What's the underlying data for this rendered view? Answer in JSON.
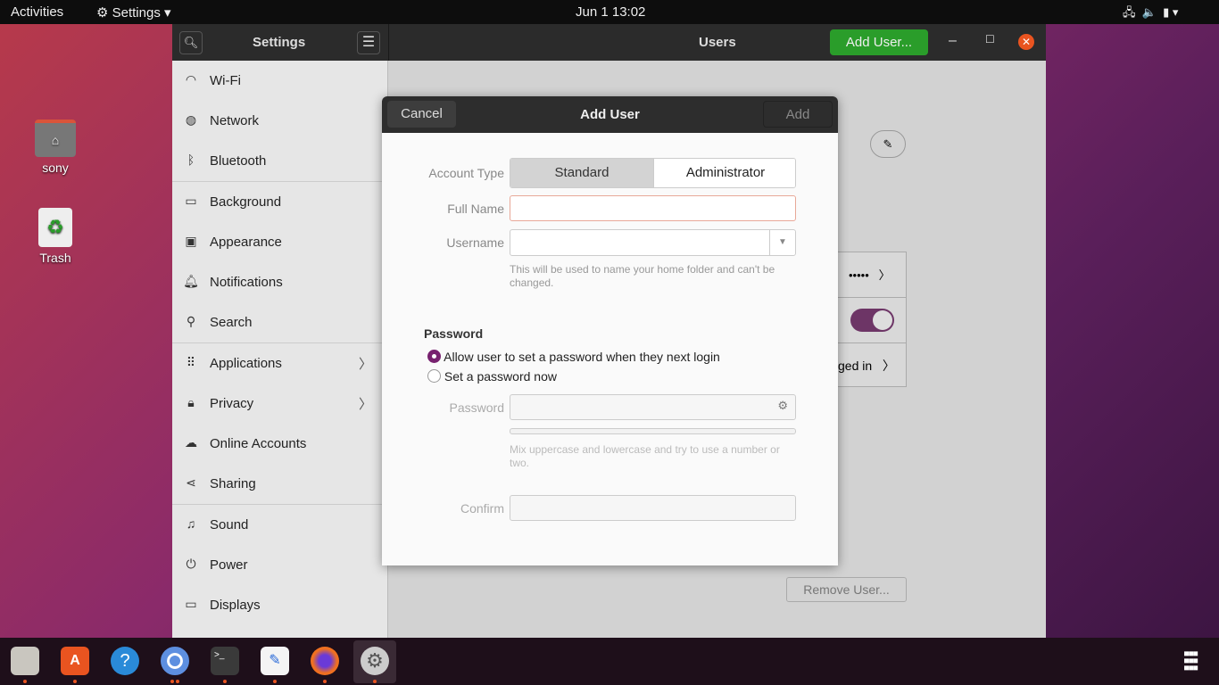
{
  "topbar": {
    "activities": "Activities",
    "app_menu": "Settings",
    "clock": "Jun 1  13:02"
  },
  "desktop": {
    "icons": [
      {
        "label": "sony",
        "icon": "home-folder-icon"
      },
      {
        "label": "Trash",
        "icon": "trash-icon"
      }
    ]
  },
  "window": {
    "sidebar_title": "Settings",
    "panel_title": "Users",
    "add_user_label": "Add User...",
    "accent": "#2a9d2a"
  },
  "sidebar": {
    "items": [
      {
        "label": "Wi-Fi",
        "icon": "wifi-icon"
      },
      {
        "label": "Network",
        "icon": "network-icon"
      },
      {
        "label": "Bluetooth",
        "icon": "bluetooth-icon"
      },
      {
        "label": "Background",
        "icon": "background-icon"
      },
      {
        "label": "Appearance",
        "icon": "appearance-icon"
      },
      {
        "label": "Notifications",
        "icon": "bell-icon"
      },
      {
        "label": "Search",
        "icon": "search-icon"
      },
      {
        "label": "Applications",
        "icon": "apps-icon"
      },
      {
        "label": "Privacy",
        "icon": "lock-icon"
      },
      {
        "label": "Online Accounts",
        "icon": "cloud-icon"
      },
      {
        "label": "Sharing",
        "icon": "share-icon"
      },
      {
        "label": "Sound",
        "icon": "music-icon"
      },
      {
        "label": "Power",
        "icon": "power-icon"
      },
      {
        "label": "Displays",
        "icon": "display-icon"
      }
    ]
  },
  "users_panel": {
    "password_mask": "•••••",
    "logged_in_partial": "ged in",
    "remove_user": "Remove User...",
    "toggle_on": true
  },
  "dialog": {
    "title": "Add User",
    "cancel": "Cancel",
    "add": "Add",
    "account_type_label": "Account Type",
    "account_types": [
      "Standard",
      "Administrator"
    ],
    "selected_type": "Standard",
    "full_name_label": "Full Name",
    "full_name_value": "",
    "username_label": "Username",
    "username_value": "",
    "username_hint": "This will be used to name your home folder and can't be changed.",
    "password_section": "Password",
    "radio_options": [
      "Allow user to set a password when they next login",
      "Set a password now"
    ],
    "selected_radio": 0,
    "password_label": "Password",
    "password_hint": "Mix uppercase and lowercase and try to use a number or two.",
    "confirm_label": "Confirm",
    "radio_color": "#77216f"
  },
  "dock": {
    "apps": [
      "Files",
      "Ubuntu Software",
      "Help",
      "Chromium",
      "Terminal",
      "Text Editor",
      "Firefox",
      "Settings"
    ]
  }
}
